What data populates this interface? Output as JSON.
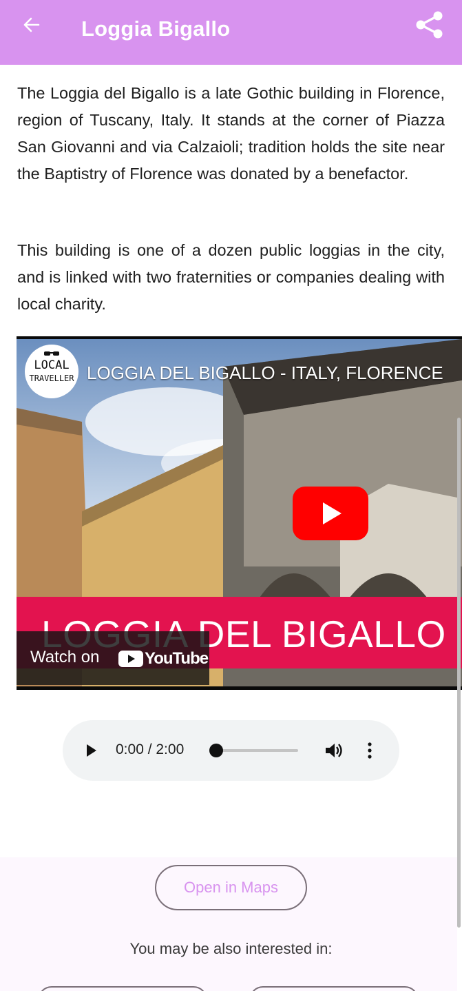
{
  "appbar": {
    "title": "Loggia Bigallo",
    "back_icon": "arrow-left-icon",
    "share_icon": "share-icon",
    "background": "#d893ef"
  },
  "content": {
    "paragraph_1": "The Loggia del Bigallo is a late Gothic building in Florence, region of Tuscany, Italy. It stands at the corner of Piazza San Giovanni and via Calzaioli; tradition holds the site near the Baptistry of Florence was donated by a benefactor.",
    "paragraph_2": "This building is one of a dozen public loggias in the city, and is linked with two fraternities or companies dealing with local charity."
  },
  "video": {
    "title": "LOGGIA DEL BIGALLO - ITALY, FLORENCE",
    "channel_logo_line1": "LOCAL",
    "channel_logo_line2": "TRAVELLER",
    "banner_text": "LOGGIA DEL BIGALLO",
    "watch_on": "Watch on",
    "youtube_label": "YouTube",
    "banner_color": "#e3134f"
  },
  "audio": {
    "time": "0:00 / 2:00",
    "progress": 0,
    "play_icon": "play-icon",
    "volume_icon": "volume-icon",
    "more_icon": "more-vert-icon"
  },
  "actions": {
    "open_maps_label": "Open in Maps",
    "interested_label": "You may be also interested in:"
  }
}
